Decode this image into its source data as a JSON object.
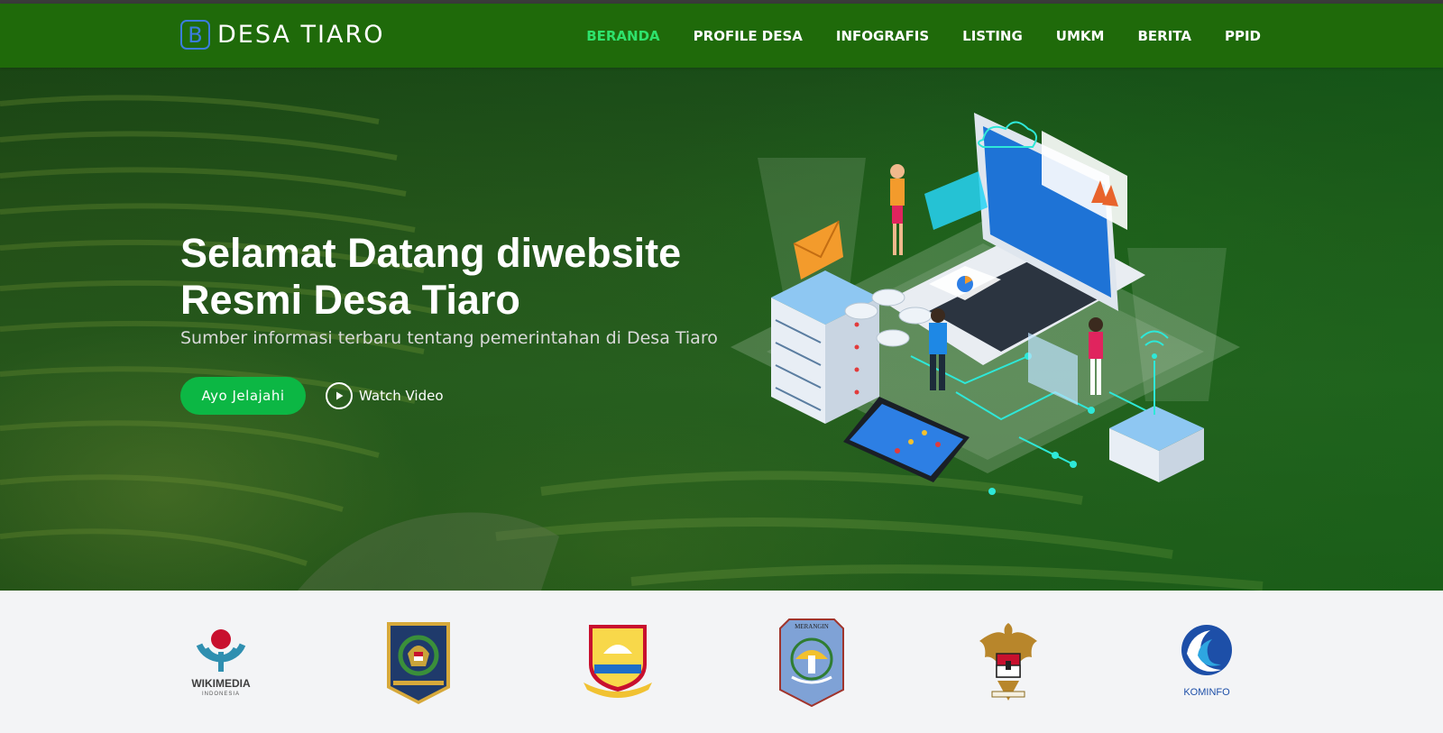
{
  "navbar": {
    "logo_letter": "B",
    "brand": "DESA TIARO",
    "links": [
      {
        "label": "BERANDA",
        "active": true
      },
      {
        "label": "PROFILE DESA",
        "active": false
      },
      {
        "label": "INFOGRAFIS",
        "active": false
      },
      {
        "label": "LISTING",
        "active": false
      },
      {
        "label": "UMKM",
        "active": false
      },
      {
        "label": "BERITA",
        "active": false
      },
      {
        "label": "PPID",
        "active": false
      }
    ]
  },
  "hero": {
    "title": "Selamat Datang diwebsite Resmi Desa Tiaro",
    "subtitle": "Sumber informasi terbaru tentang pemerintahan di Desa Tiaro",
    "primary_button": "Ayo Jelajahi",
    "video_link": "Watch Video"
  },
  "partners": {
    "wikimedia": {
      "name": "WIKIMEDIA",
      "sub": "INDONESIA"
    },
    "kominfo": {
      "name": "KOMINFO"
    },
    "merangin": {
      "name": "MERANGIN"
    }
  },
  "colors": {
    "navbar": "#1f6a0a",
    "active_link": "#2ee26c",
    "primary_button": "#0cb744"
  }
}
